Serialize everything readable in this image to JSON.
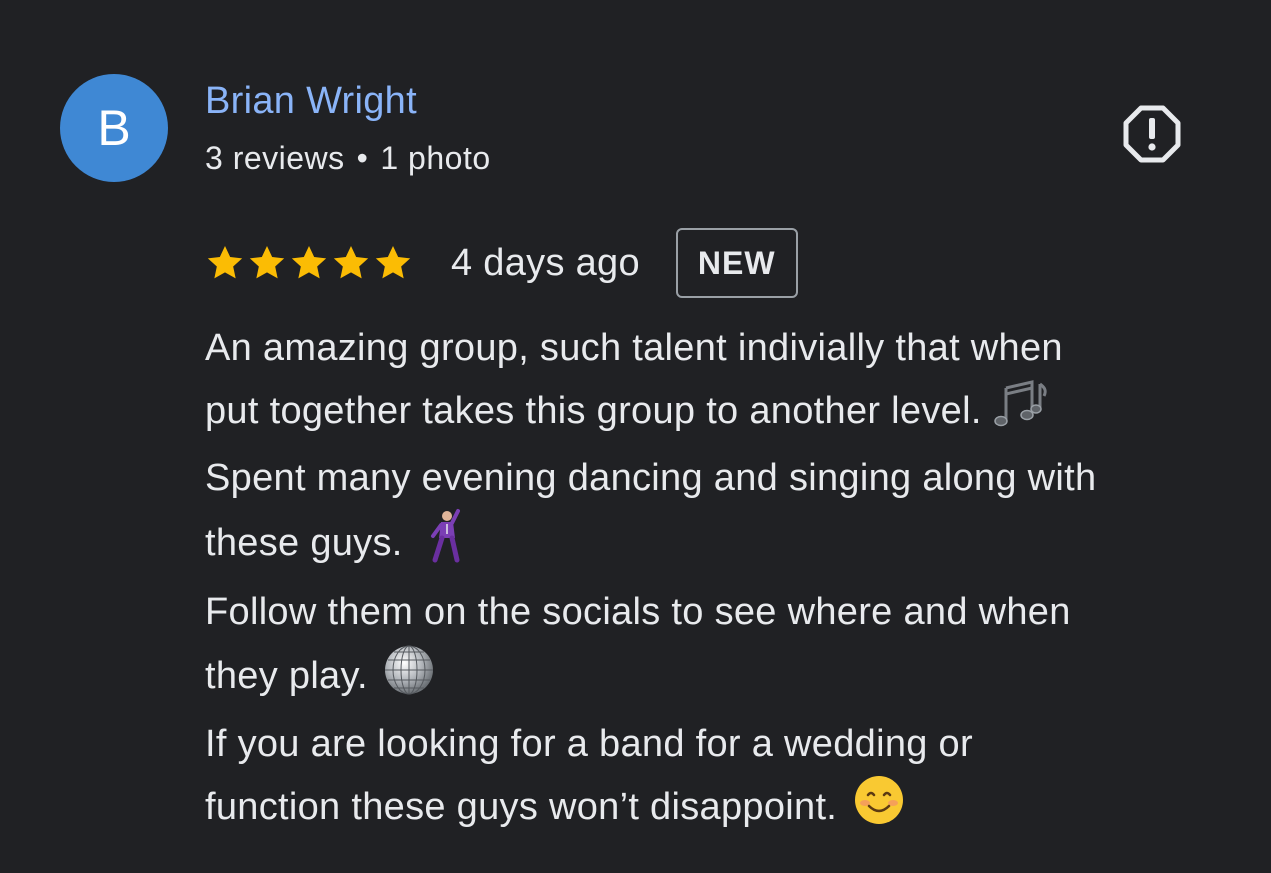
{
  "review": {
    "avatar_letter": "B",
    "author_name": "Brian Wright",
    "reviews_count": "3 reviews",
    "separator": "•",
    "photos_count": "1 photo",
    "report_icon": "report-flag-icon",
    "rating": 5,
    "rating_max": 5,
    "date": "4 days ago",
    "badge": "NEW",
    "text_lines": [
      "An amazing group, such talent indivially that when",
      "put together takes this group to another level.",
      "Spent many evening dancing and singing along with",
      "these guys.",
      "Follow them on the socials to see where and when",
      "they play.",
      "If you are looking for a band for a wedding or",
      "function these guys won’t disappoint."
    ],
    "emojis": {
      "music_notes": "music-notes-icon",
      "dancer": "man-dancing-icon",
      "disco_ball": "mirror-ball-icon",
      "smile": "smiling-face-icon"
    }
  },
  "colors": {
    "background": "#202124",
    "author": "#8ab4f8",
    "avatar": "#3f88d4",
    "star": "#fbbc04",
    "text": "#e8eaed",
    "badge_border": "#9aa0a6"
  }
}
